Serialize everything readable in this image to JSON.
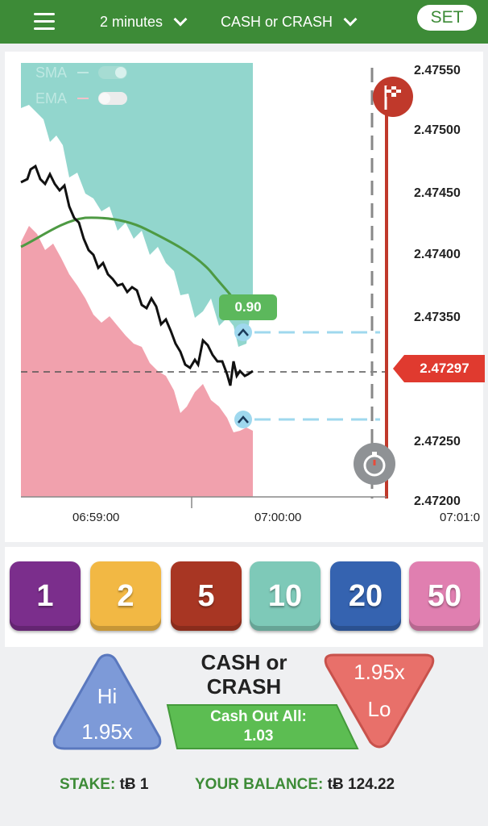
{
  "header": {
    "time_selector": "2 minutes",
    "game_selector": "CASH or CRASH",
    "set_label": "SET"
  },
  "chart": {
    "legend": {
      "sma_label": "SMA",
      "ema_label": "EMA",
      "sma_on": true,
      "ema_on": false
    },
    "y_ticks": [
      "2.47550",
      "2.47500",
      "2.47450",
      "2.47400",
      "2.47350",
      "2.47250",
      "2.47200"
    ],
    "x_ticks": [
      "06:59:00",
      "07:00:00",
      "07:01:0"
    ],
    "current_price": "2.47297",
    "barrier_value": "0.90",
    "colors": {
      "upper_band": "#7fcfc4",
      "lower_band": "#ee8a98",
      "price_line": "#111111",
      "ma_line": "#4e9a43",
      "barrier_line": "#9fd8ee",
      "expiry_line": "#c0392b"
    }
  },
  "chips": [
    {
      "label": "1",
      "color": "#7b2e8c"
    },
    {
      "label": "2",
      "color": "#f2b844"
    },
    {
      "label": "5",
      "color": "#a83623"
    },
    {
      "label": "10",
      "color": "#7ec9b8"
    },
    {
      "label": "20",
      "color": "#3563b0"
    },
    {
      "label": "50",
      "color": "#e07fb0"
    }
  ],
  "controls": {
    "title_line1": "CASH or",
    "title_line2": "CRASH",
    "hi_label": "Hi",
    "hi_multiplier": "1.95x",
    "lo_label": "Lo",
    "lo_multiplier": "1.95x",
    "cashout_label": "Cash Out All:",
    "cashout_value": "1.03"
  },
  "footer": {
    "stake_label": "STAKE:",
    "stake_value": "tɃ 1",
    "balance_label": "YOUR BALANCE:",
    "balance_value": "tɃ 124.22"
  }
}
